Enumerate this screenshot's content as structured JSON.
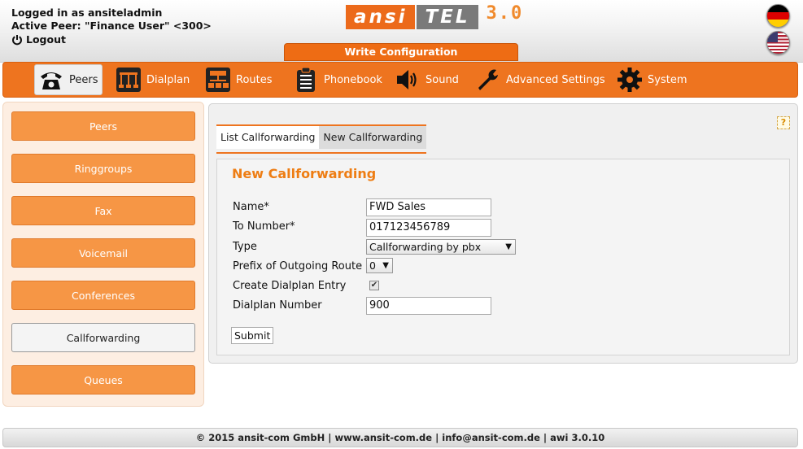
{
  "header": {
    "login_line": "Logged in as ansiteladmin",
    "peer_line": "Active Peer: \"Finance User\" <300>",
    "logout_label": "Logout",
    "write_config_label": "Write Configuration",
    "logo_part1": "ansi",
    "logo_part2": "TEL",
    "logo_version": "3.0"
  },
  "nav": {
    "items": [
      {
        "label": "Peers",
        "icon": "phone-icon",
        "active": true
      },
      {
        "label": "Dialplan",
        "icon": "dialplan-icon"
      },
      {
        "label": "Routes",
        "icon": "routes-icon"
      },
      {
        "label": "Phonebook",
        "icon": "phonebook-icon"
      },
      {
        "label": "Sound",
        "icon": "speaker-icon"
      },
      {
        "label": "Advanced Settings",
        "icon": "wrench-icon"
      },
      {
        "label": "System",
        "icon": "gear-icon"
      }
    ]
  },
  "sidebar": {
    "items": [
      {
        "label": "Peers"
      },
      {
        "label": "Ringgroups"
      },
      {
        "label": "Fax"
      },
      {
        "label": "Voicemail"
      },
      {
        "label": "Conferences"
      },
      {
        "label": "Callforwarding",
        "active": true
      },
      {
        "label": "Queues"
      }
    ]
  },
  "tabs": {
    "list_label": "List Callforwarding",
    "new_label": "New Callforwarding"
  },
  "help_label": "?",
  "form": {
    "title": "New Callforwarding",
    "name_label": "Name*",
    "name_value": "FWD Sales",
    "to_number_label": "To Number*",
    "to_number_value": "017123456789",
    "type_label": "Type",
    "type_value": "Callforwarding by pbx",
    "prefix_label": "Prefix of Outgoing Route",
    "prefix_value": "0",
    "create_dialplan_label": "Create Dialplan Entry",
    "create_dialplan_checked": true,
    "dialplan_number_label": "Dialplan Number",
    "dialplan_number_value": "900",
    "submit_label": "Submit"
  },
  "footer": {
    "text": "© 2015 ansit-com GmbH | www.ansit-com.de | info@ansit-com.de | awi 3.0.10"
  },
  "colors": {
    "accent": "#ee741f",
    "sidebar_button": "#f69645",
    "form_title": "#ee7d13"
  }
}
